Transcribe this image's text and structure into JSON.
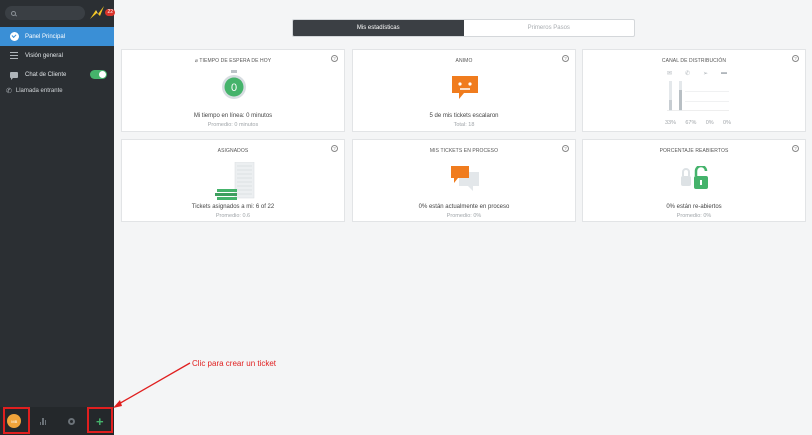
{
  "sidebar": {
    "logo_badge": "22",
    "items": [
      {
        "label": "Panel Principal"
      },
      {
        "label": "Visión general"
      },
      {
        "label": "Chat de Cliente"
      }
    ],
    "incoming_call": "Llamada entrante",
    "avatar_initials": "MB"
  },
  "tabs": [
    "Mis estadísticas",
    "Primeros Pasos"
  ],
  "cards": {
    "wait": {
      "title": "⌀ TIEMPO DE ESPERA DE HOY",
      "value": "0",
      "line1": "Mi tiempo en línea: 0 minutos",
      "line2": "Promedio: 0 minutos"
    },
    "mood": {
      "title": "ANIMO",
      "line1": "5 de mis tickets escalaron",
      "line2": "Total: 18"
    },
    "channel": {
      "title": "CANAL DE DISTRIBUCIÓN",
      "percents": [
        "33%",
        "67%",
        "0%",
        "0%"
      ]
    },
    "assigned": {
      "title": "ASIGNADOS",
      "line1": "Tickets asignados a mi: 6 of 22",
      "line2": "Promedio: 0.6"
    },
    "in_process": {
      "title": "MIS TICKETS EN PROCESO",
      "line1": "0% están actualmente en proceso",
      "line2": "Promedio: 0%"
    },
    "reopen": {
      "title": "PORCENTAJE REABIERTOS",
      "line1": "0% están re-abiertos",
      "line2": "Promedio: 0%"
    }
  },
  "annotation": "Clic para crear un ticket",
  "colors": {
    "accent": "#3a8fd6",
    "green": "#45b36b",
    "orange": "#f07c1e",
    "red": "#e01f1f"
  }
}
